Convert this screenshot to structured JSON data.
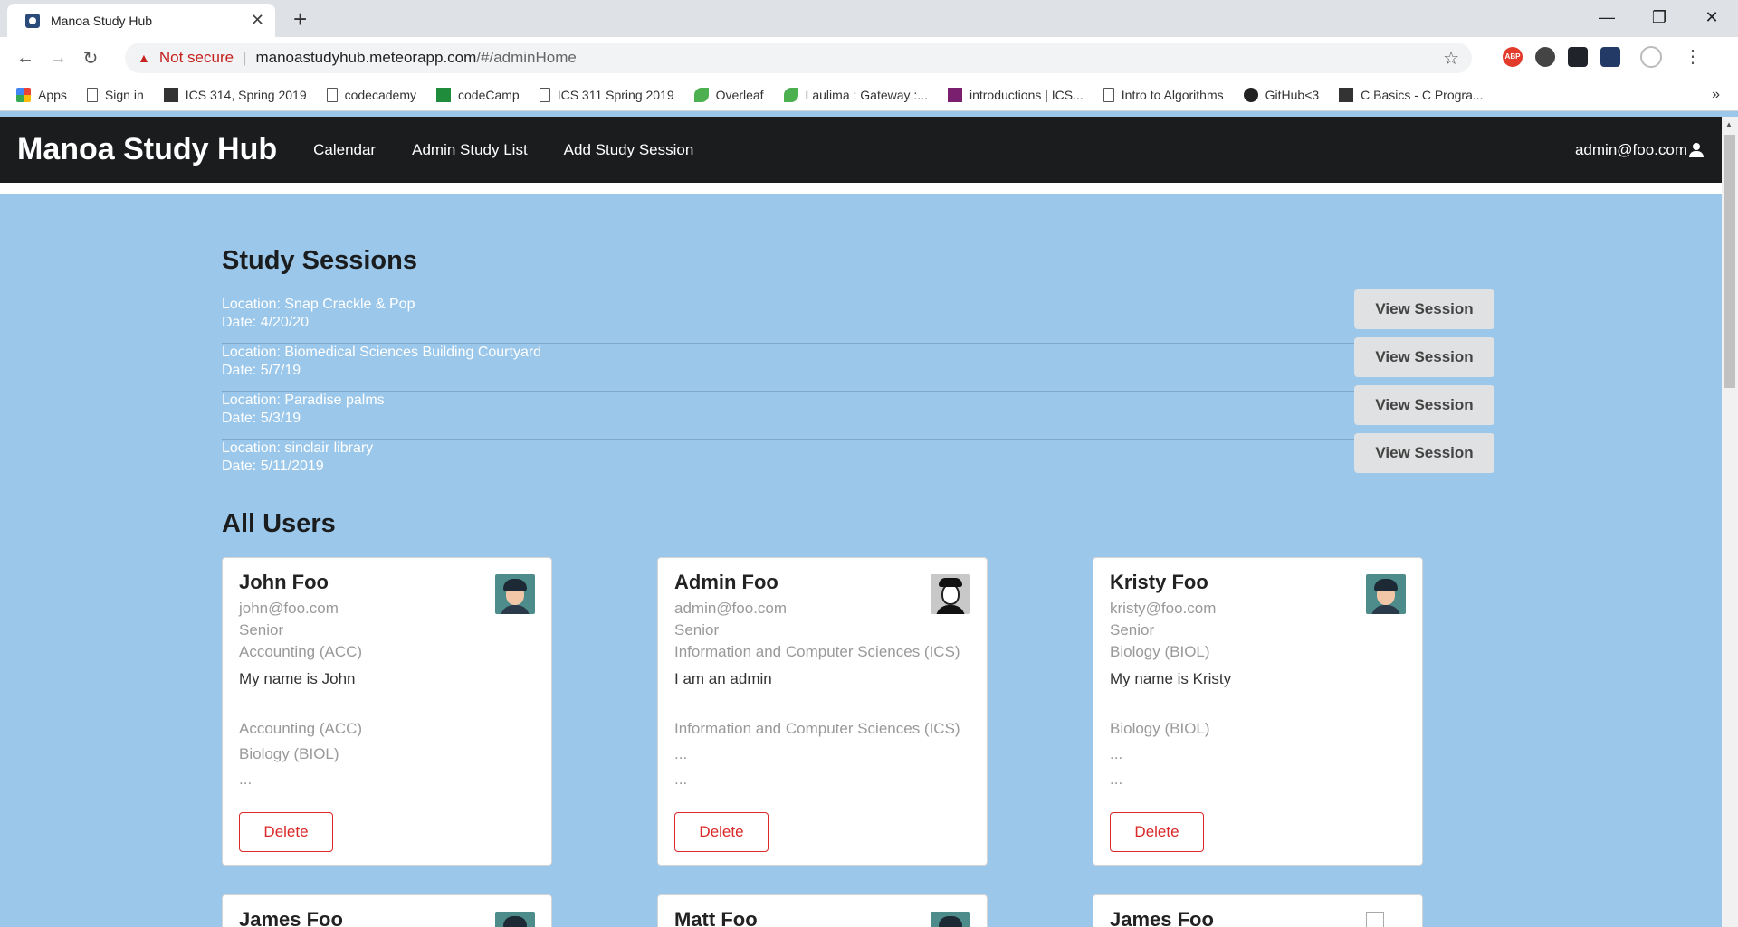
{
  "browser": {
    "tab_title": "Manoa Study Hub",
    "not_secure": "Not secure",
    "url_host": "manoastudyhub.meteorapp.com",
    "url_path": "/#/adminHome",
    "bookmarks": [
      {
        "label": "Apps",
        "icon": "apps-icon"
      },
      {
        "label": "Sign in",
        "icon": "page-icon"
      },
      {
        "label": "ICS 314, Spring 2019",
        "icon": "site-icon"
      },
      {
        "label": "codecademy",
        "icon": "codecademy-icon"
      },
      {
        "label": "codeCamp",
        "icon": "codecamp-icon"
      },
      {
        "label": "ICS 311 Spring 2019",
        "icon": "page-icon"
      },
      {
        "label": "Overleaf",
        "icon": "overleaf-icon"
      },
      {
        "label": "Laulima : Gateway :...",
        "icon": "laulima-icon"
      },
      {
        "label": "introductions | ICS...",
        "icon": "slack-icon"
      },
      {
        "label": "Intro to Algorithms",
        "icon": "page-icon"
      },
      {
        "label": "GitHub<3",
        "icon": "github-icon"
      },
      {
        "label": "C Basics - C Progra...",
        "icon": "terminal-icon"
      }
    ]
  },
  "nav": {
    "brand": "Manoa Study Hub",
    "links": [
      "Calendar",
      "Admin Study List",
      "Add Study Session"
    ],
    "user": "admin@foo.com"
  },
  "sessions": {
    "title": "Study Sessions",
    "button_label": "View Session",
    "items": [
      {
        "location": "Location: Snap Crackle & Pop",
        "date": "Date: 4/20/20"
      },
      {
        "location": "Location: Biomedical Sciences Building Courtyard",
        "date": "Date: 5/7/19"
      },
      {
        "location": "Location: Paradise palms",
        "date": "Date: 5/3/19"
      },
      {
        "location": "Location: sinclair library",
        "date": "Date: 5/11/2019"
      }
    ]
  },
  "users": {
    "title": "All Users",
    "delete_label": "Delete",
    "cards": [
      {
        "name": "John Foo",
        "email": "john@foo.com",
        "year": "Senior",
        "major": "Accounting (ACC)",
        "bio": "My name is John",
        "tags": [
          "Accounting (ACC)",
          "Biology (BIOL)",
          "..."
        ],
        "avatar": "woman-avatar-icon"
      },
      {
        "name": "Admin Foo",
        "email": "admin@foo.com",
        "year": "Senior",
        "major": "Information and Computer Sciences (ICS)",
        "bio": "I am an admin",
        "tags": [
          "Information and Computer Sciences (ICS)",
          "...",
          "..."
        ],
        "avatar": "man-glasses-avatar-icon"
      },
      {
        "name": "Kristy Foo",
        "email": "kristy@foo.com",
        "year": "Senior",
        "major": "Biology (BIOL)",
        "bio": "My name is Kristy",
        "tags": [
          "Biology (BIOL)",
          "...",
          "..."
        ],
        "avatar": "woman-avatar-icon"
      },
      {
        "name": "James Foo",
        "avatar": "man-avatar-icon"
      },
      {
        "name": "Matt Foo",
        "avatar": "man-avatar-icon"
      },
      {
        "name": "James Foo",
        "avatar": "broken-image-icon"
      }
    ]
  }
}
